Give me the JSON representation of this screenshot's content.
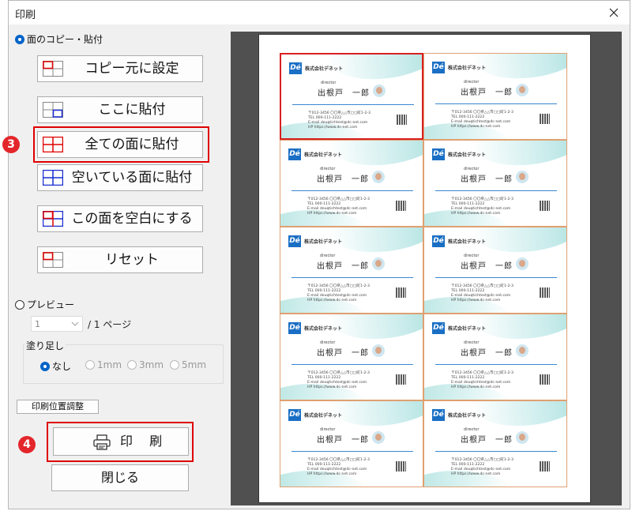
{
  "window": {
    "title": "印刷"
  },
  "mode": {
    "copy_paste_label": "面のコピー・貼付",
    "preview_label": "プレビュー"
  },
  "buttons": [
    {
      "label": "コピー元に設定",
      "icon": "grid-copy-source-icon"
    },
    {
      "label": "ここに貼付",
      "icon": "grid-paste-here-icon"
    },
    {
      "label": "全ての面に貼付",
      "icon": "grid-paste-all-icon"
    },
    {
      "label": "空いている面に貼付",
      "icon": "grid-paste-empty-icon"
    },
    {
      "label": "この面を空白にする",
      "icon": "grid-clear-icon"
    },
    {
      "label": "リセット",
      "icon": "grid-reset-icon"
    }
  ],
  "preview": {
    "page_select": "1",
    "page_total": "/ 1 ページ"
  },
  "bleed": {
    "label": "塗り足し",
    "options": [
      "なし",
      "1mm",
      "3mm",
      "5mm"
    ],
    "selected": "なし"
  },
  "adjust_button": "印刷位置調整",
  "print_button": "印 刷",
  "close_button": "閉じる",
  "badges": {
    "step3": "3",
    "step4": "4"
  },
  "card": {
    "logo": "Dé",
    "company": "株式会社デネット",
    "role": "director",
    "name": "出根戸　一郎",
    "address": "〒012-3456 〇〇県△△市□□町1-2-3",
    "tel": "TEL 000-111-2222",
    "email": "E-mail deuqtichtest@dc-net.com",
    "hp": "HP https://www.dc-net.com"
  },
  "colors": {
    "accent": "#0064c8",
    "highlight": "#e00000",
    "badge": "#e3262b"
  }
}
